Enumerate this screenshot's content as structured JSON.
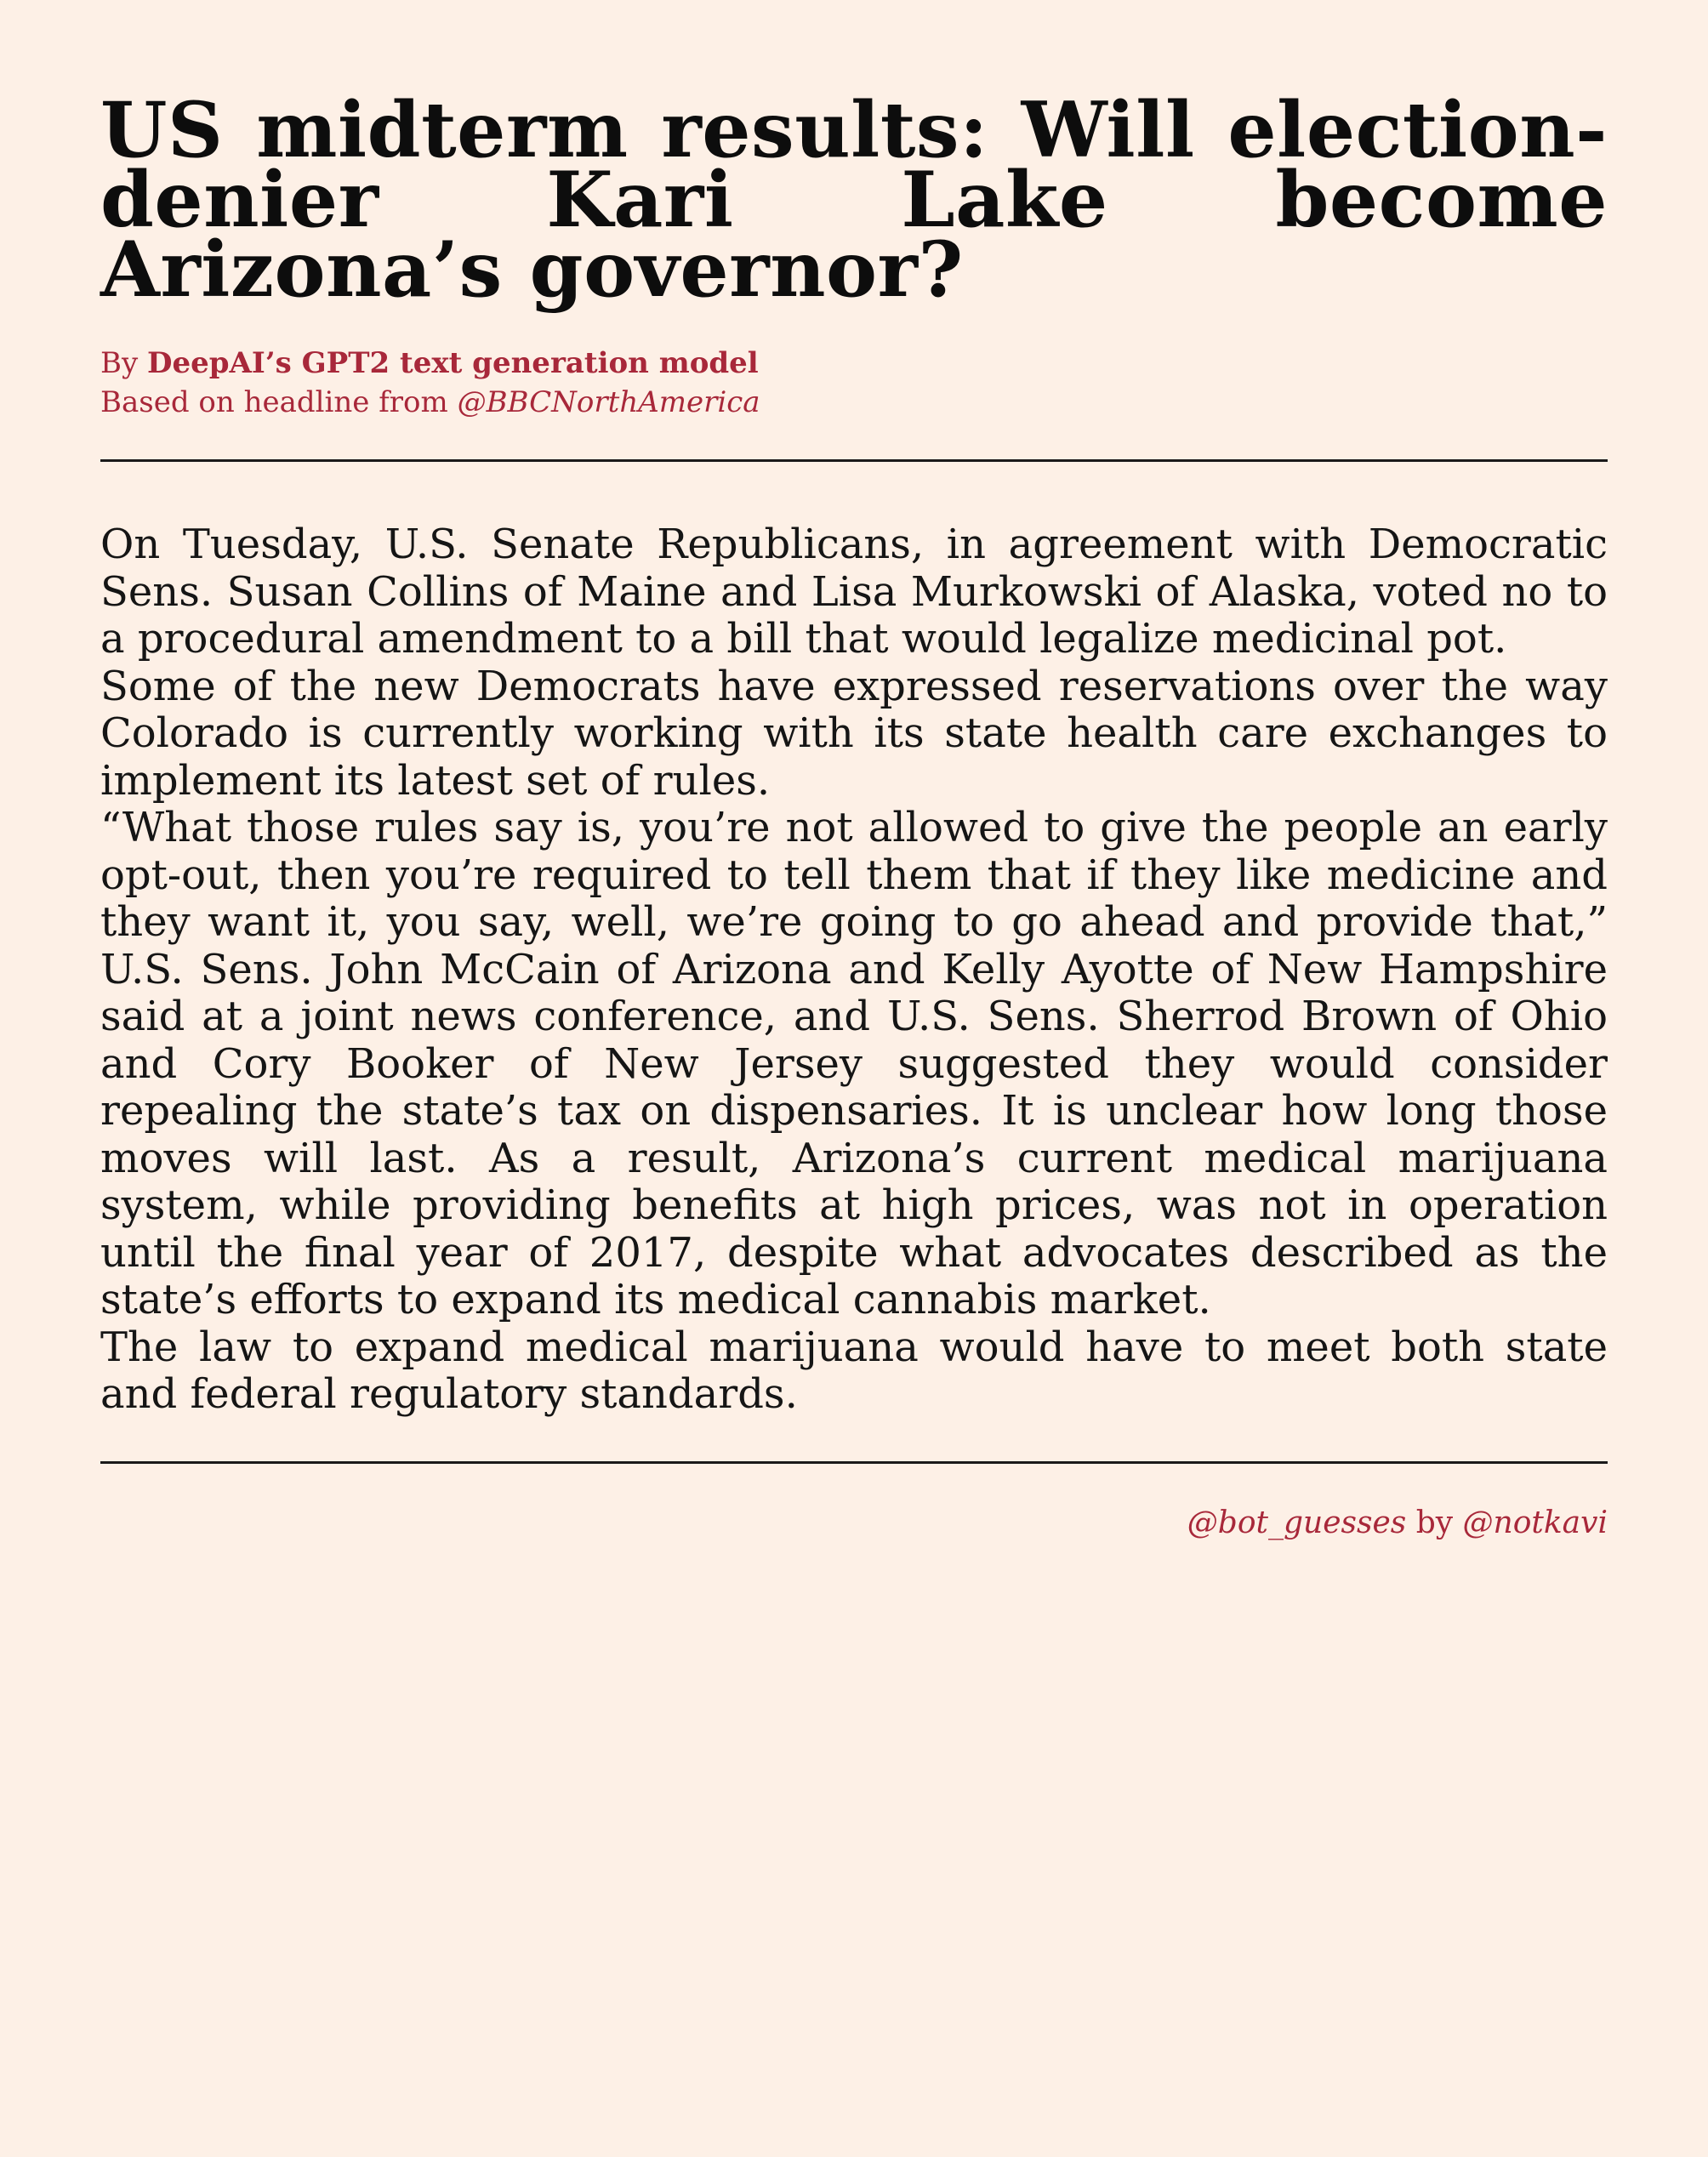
{
  "headline": "US midterm results: Will election-denier Kari Lake become Arizona’s governor?",
  "byline": {
    "prefix": "By ",
    "author": "DeepAI’s GPT2 text generation model",
    "source_prefix": "Based on headline from ",
    "source_handle": "@BBCNorthAmerica"
  },
  "article": {
    "paragraphs": [
      "On Tuesday, U.S. Senate Republicans, in agreement with Democratic Sens. Susan Collins of Maine and Lisa Murkowski of Alaska, voted no to a procedural amendment to a bill that would legalize medicinal pot.",
      "Some of the new Democrats have expressed reservations over the way Colorado is currently working with its state health care exchanges to implement its latest set of rules.",
      "“What those rules say is, you’re not allowed to give the people an early opt-out, then you’re required to tell them that if they like medicine and they want it, you say, well, we’re going to go ahead and provide that,” U.S. Sens. John McCain of Arizona and Kelly Ayotte of New Hampshire said at a joint news conference, and U.S. Sens. Sherrod Brown of Ohio and Cory Booker of New Jersey suggested they would consider repealing the state’s tax on dispensaries. It is unclear how long those moves will last. As a result, Arizona’s current medical marijuana system, while providing benefits at high prices, was not in operation until the final year of 2017, despite what advocates described as the state’s efforts to expand its medical cannabis market.",
      "The law to expand medical marijuana would have to meet both state and federal regulatory standards."
    ]
  },
  "footer": {
    "bot_handle": "@bot_guesses",
    "by": " by ",
    "creator_handle": "@notkavi"
  },
  "colors": {
    "background": "#fdf0e6",
    "accent": "#a8283a",
    "text": "#111111"
  }
}
